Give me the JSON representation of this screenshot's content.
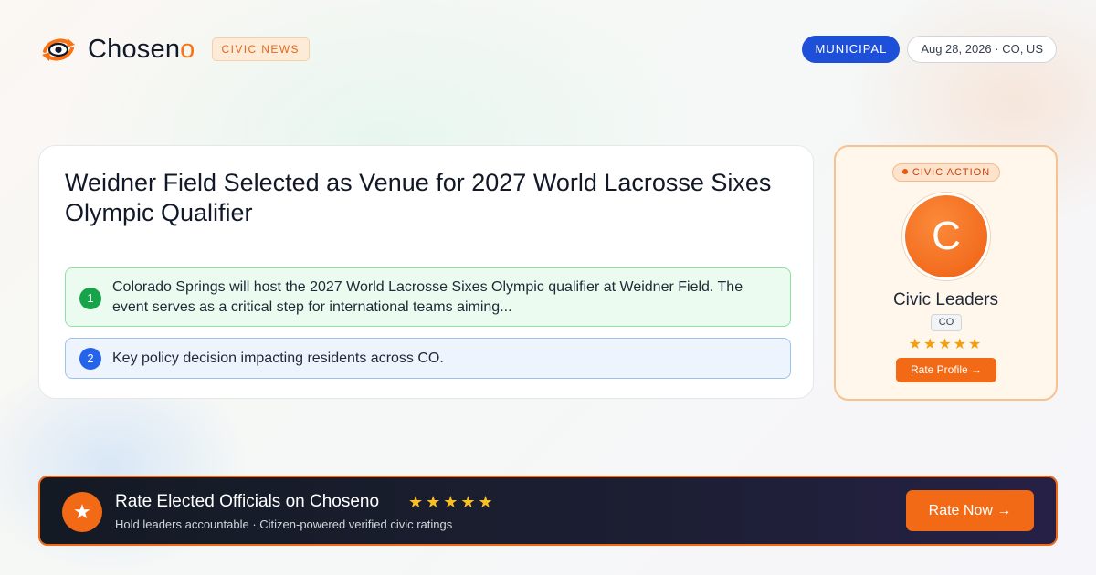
{
  "brand": {
    "name_main": "Chosen",
    "name_accent": "o",
    "badge": "CIVIC NEWS",
    "logo_icon": "eye-refresh-logo-icon",
    "accent_color": "#f97316"
  },
  "header": {
    "category": "MUNICIPAL",
    "meta": "Aug 28, 2026 · CO, US"
  },
  "article": {
    "headline": "Weidner Field Selected as Venue for 2027 World Lacrosse Sixes Olympic Qualifier",
    "points": [
      {
        "number": "1",
        "text": "Colorado Springs will host the 2027 World Lacrosse Sixes Olympic qualifier at Weidner Field. The event serves as a critical step for international teams aiming..."
      },
      {
        "number": "2",
        "text": "Key policy decision impacting residents across CO."
      }
    ]
  },
  "civic_card": {
    "badge": "CIVIC ACTION",
    "avatar_letter": "C",
    "name": "Civic Leaders",
    "state": "CO",
    "stars": "★★★★★",
    "button_label": "Rate Profile →"
  },
  "banner": {
    "icon": "star-icon",
    "title": "Rate Elected Officials on Choseno",
    "stars": "★★★★★",
    "subtitle": "Hold leaders accountable · Citizen-powered verified civic ratings",
    "button_label": "Rate Now →"
  }
}
